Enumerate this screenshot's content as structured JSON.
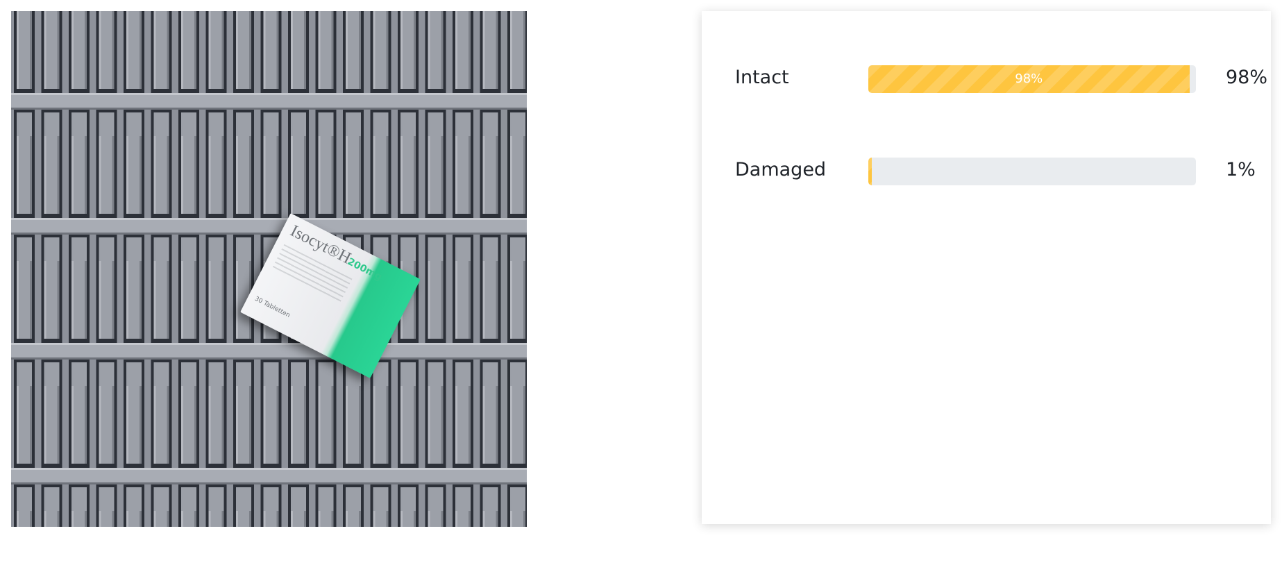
{
  "image": {
    "package_brand": "Isocyt®H",
    "package_dose": "200mg",
    "package_count": "30 Tabletten"
  },
  "results": [
    {
      "label": "Intact",
      "value": 0.98,
      "bar_text": "98%",
      "percent_text": "98%",
      "color": "#fec53f"
    },
    {
      "label": "Damaged",
      "value": 0.01,
      "bar_text": "",
      "percent_text": "1%",
      "color": "#fec53f"
    }
  ]
}
